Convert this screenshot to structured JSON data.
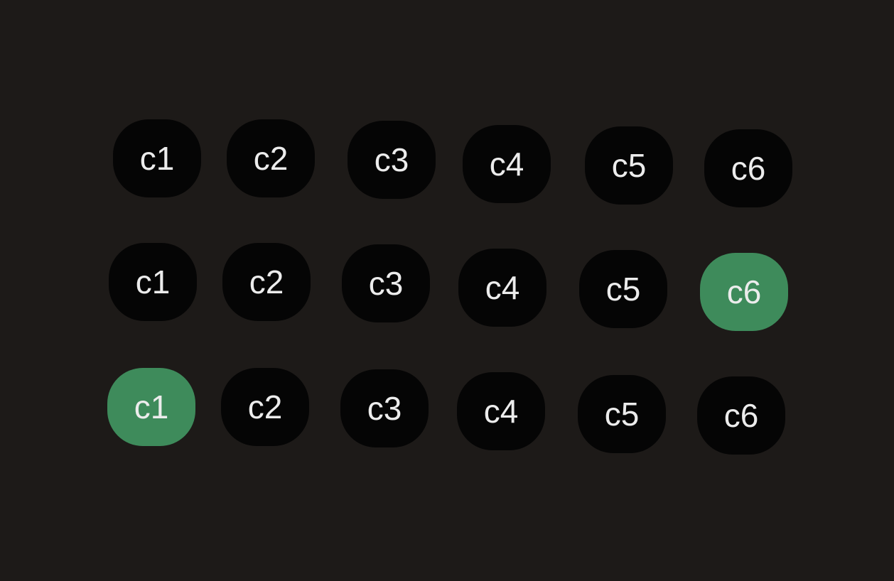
{
  "colors": {
    "background": "#1d1a18",
    "cell_default": "#050505",
    "cell_active": "#3e8b5b",
    "text": "#ececec"
  },
  "grid": {
    "rows": [
      {
        "cells": [
          {
            "label": "c1",
            "active": false
          },
          {
            "label": "c2",
            "active": false
          },
          {
            "label": "c3",
            "active": false
          },
          {
            "label": "c4",
            "active": false
          },
          {
            "label": "c5",
            "active": false
          },
          {
            "label": "c6",
            "active": false
          }
        ]
      },
      {
        "cells": [
          {
            "label": "c1",
            "active": false
          },
          {
            "label": "c2",
            "active": false
          },
          {
            "label": "c3",
            "active": false
          },
          {
            "label": "c4",
            "active": false
          },
          {
            "label": "c5",
            "active": false
          },
          {
            "label": "c6",
            "active": true
          }
        ]
      },
      {
        "cells": [
          {
            "label": "c1",
            "active": true
          },
          {
            "label": "c2",
            "active": false
          },
          {
            "label": "c3",
            "active": false
          },
          {
            "label": "c4",
            "active": false
          },
          {
            "label": "c5",
            "active": false
          },
          {
            "label": "c6",
            "active": false
          }
        ]
      }
    ]
  }
}
